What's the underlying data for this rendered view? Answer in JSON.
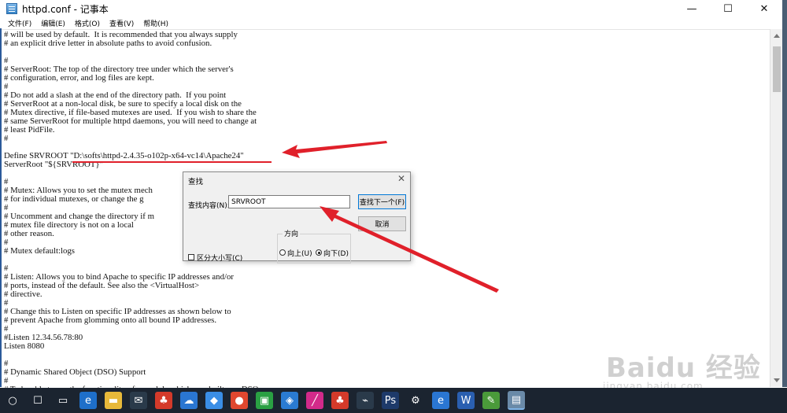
{
  "window": {
    "title": "httpd.conf - 记事本",
    "minimize": "—",
    "maximize": "☐",
    "close": "✕"
  },
  "menu": [
    "文件(F)",
    "编辑(E)",
    "格式(O)",
    "查看(V)",
    "帮助(H)"
  ],
  "editor_lines": [
    "# will be used by default.  It is recommended that you always supply",
    "# an explicit drive letter in absolute paths to avoid confusion.",
    "",
    "#",
    "# ServerRoot: The top of the directory tree under which the server's",
    "# configuration, error, and log files are kept.",
    "#",
    "# Do not add a slash at the end of the directory path.  If you point",
    "# ServerRoot at a non-local disk, be sure to specify a local disk on the",
    "# Mutex directive, if file-based mutexes are used.  If you wish to share the",
    "# same ServerRoot for multiple httpd daemons, you will need to change at",
    "# least PidFile.",
    "#",
    "",
    "Define SRVROOT \"D:\\softs\\httpd-2.4.35-o102p-x64-vc14\\Apache24\"",
    "ServerRoot \"${SRVROOT}\"",
    "",
    "#",
    "# Mutex: Allows you to set the mutex mech",
    "# for individual mutexes, or change the g",
    "#",
    "# Uncomment and change the directory if m",
    "# mutex file directory is not on a local",
    "# other reason.",
    "#",
    "# Mutex default:logs",
    "",
    "#",
    "# Listen: Allows you to bind Apache to specific IP addresses and/or",
    "# ports, instead of the default. See also the <VirtualHost>",
    "# directive.",
    "#",
    "# Change this to Listen on specific IP addresses as shown below to",
    "# prevent Apache from glomming onto all bound IP addresses.",
    "#",
    "#Listen 12.34.56.78:80",
    "Listen 8080",
    "",
    "#",
    "# Dynamic Shared Object (DSO) Support",
    "#",
    "# To be able to use the functionality of a module which was built as a DSO you"
  ],
  "find_dialog": {
    "title": "查找",
    "close": "✕",
    "find_label": "查找内容(N):",
    "find_value": "SRVROOT",
    "find_next": "查找下一个(F)",
    "cancel": "取消",
    "direction_label": "方向",
    "up_label": "向上(U)",
    "down_label": "向下(D)",
    "match_case": "区分大小写(C)",
    "direction_selected": "down",
    "match_case_checked": false
  },
  "watermark": {
    "main": "Baidu 经验",
    "sub": "jingyan.baidu.com"
  },
  "taskbar": [
    "start-icon",
    "search-icon",
    "task-view-icon",
    "edge-icon",
    "file-explorer-icon",
    "mail-icon",
    "qq-icon",
    "baidu-netdisk-icon",
    "feishu-icon",
    "chrome-icon",
    "wechat-icon",
    "vscode-icon",
    "pen-icon",
    "qq-icon-2",
    "tool-icon",
    "photoshop-icon",
    "settings-icon",
    "ie-icon",
    "word-icon",
    "notepad-plus-icon",
    "notepad-icon"
  ],
  "taskbar_glyphs": [
    "○",
    "☐",
    "▭",
    "e",
    "▬",
    "✉",
    "♣",
    "☁",
    "◆",
    "●",
    "▣",
    "◈",
    "╱",
    "♣",
    "⌁",
    "Ps",
    "⚙",
    "e",
    "W",
    "✎",
    "▤"
  ],
  "colors": {
    "annotation_red": "#e0202a",
    "taskbar": "#1b2430",
    "accent": "#0078d7"
  }
}
